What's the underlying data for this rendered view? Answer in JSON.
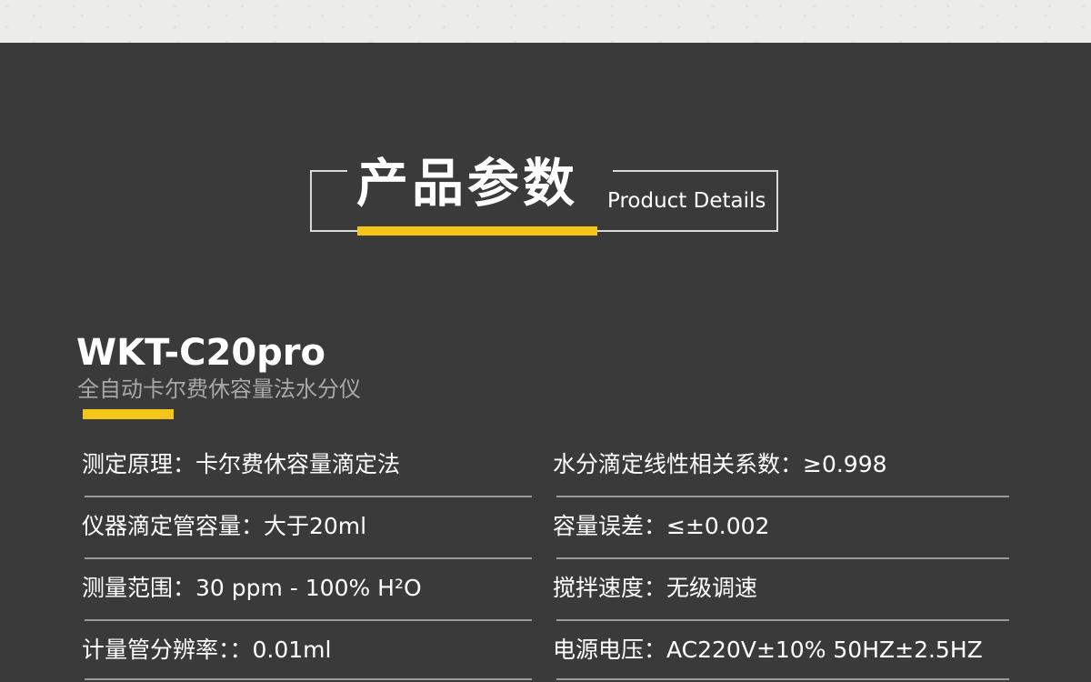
{
  "section": {
    "title_cn": "产品参数",
    "title_en": "Product Details"
  },
  "product": {
    "model": "WKT-C20pro",
    "subtitle": "全自动卡尔费休容量法水分仪"
  },
  "specs": {
    "left": [
      "测定原理：卡尔费休容量滴定法",
      "仪器滴定管容量：大于20ml",
      "测量范围：30 ppm - 100% H²O",
      "计量管分辨率：：0.01ml"
    ],
    "right": [
      "水分滴定线性相关系数：≥0.998",
      "容量误差：≤±0.002",
      "搅拌速度：无级调速",
      "电源电压：AC220V±10% 50HZ±2.5HZ"
    ]
  },
  "colors": {
    "background": "#3a3a3a",
    "accent": "#f5c518",
    "subtitle": "#a8a8a8",
    "rule": "#9a9a9a"
  }
}
